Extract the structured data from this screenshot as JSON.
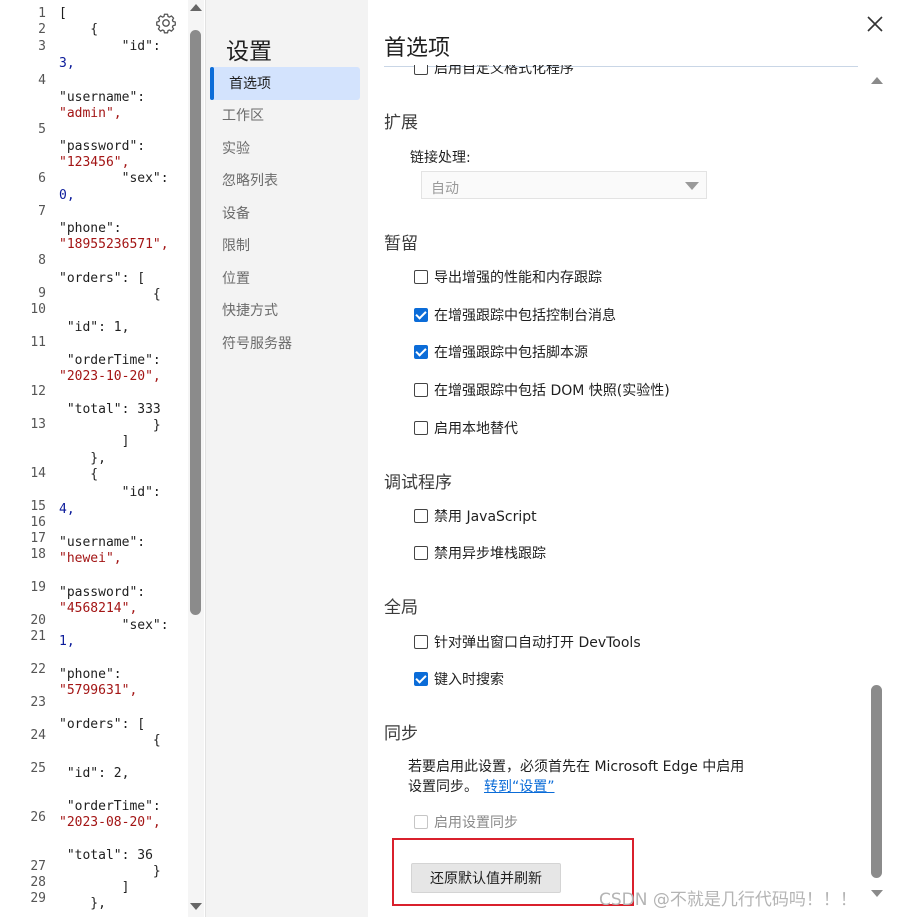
{
  "code": {
    "line_numbers": [
      "1",
      "2",
      "3",
      "4",
      "5",
      "6",
      "7",
      "8",
      "9",
      "10",
      "11",
      "12",
      "13",
      "14",
      "15",
      "16",
      "17",
      "18",
      "19",
      "20",
      "21",
      "22",
      "23",
      "24",
      "25",
      "26",
      "27",
      "28",
      "29"
    ],
    "lines": [
      {
        "text": "[",
        "kind": "k"
      },
      {
        "text": "    {",
        "kind": "k"
      },
      {
        "text": "        \"id\":",
        "kind": "k"
      },
      {
        "text": "3,",
        "kind": "n"
      },
      {
        "text": "\"username\":",
        "kind": "k"
      },
      {
        "text": "\"admin\",",
        "kind": "s"
      },
      {
        "text": "\"password\":",
        "kind": "k"
      },
      {
        "text": "\"123456\",",
        "kind": "s"
      },
      {
        "text": "        \"sex\":",
        "kind": "k"
      },
      {
        "text": "0,",
        "kind": "n"
      },
      {
        "text": "\"phone\":",
        "kind": "k"
      },
      {
        "text": "\"18955236571\",",
        "kind": "s"
      },
      {
        "text": "\"orders\": [",
        "kind": "k"
      },
      {
        "text": "            {",
        "kind": "k"
      },
      {
        "text": " \"id\": 1,",
        "kind": "k"
      },
      {
        "text": " \"orderTime\":",
        "kind": "k"
      },
      {
        "text": "\"2023-10-20\",",
        "kind": "s"
      },
      {
        "text": " \"total\": 333",
        "kind": "k"
      },
      {
        "text": "            }",
        "kind": "k"
      },
      {
        "text": "        ]",
        "kind": "k"
      },
      {
        "text": "    },",
        "kind": "k"
      },
      {
        "text": "    {",
        "kind": "k"
      },
      {
        "text": "        \"id\":",
        "kind": "k"
      },
      {
        "text": "4,",
        "kind": "n"
      },
      {
        "text": "\"username\":",
        "kind": "k"
      },
      {
        "text": "\"hewei\",",
        "kind": "s"
      },
      {
        "text": "\"password\":",
        "kind": "k"
      },
      {
        "text": "\"4568214\",",
        "kind": "s"
      },
      {
        "text": "        \"sex\":",
        "kind": "k"
      },
      {
        "text": "1,",
        "kind": "n"
      },
      {
        "text": "\"phone\":",
        "kind": "k"
      },
      {
        "text": "\"5799631\",",
        "kind": "s"
      },
      {
        "text": "\"orders\": [",
        "kind": "k"
      },
      {
        "text": "            {",
        "kind": "k"
      },
      {
        "text": " \"id\": 2,",
        "kind": "k"
      },
      {
        "text": " \"orderTime\":",
        "kind": "k"
      },
      {
        "text": "\"2023-08-20\",",
        "kind": "s"
      },
      {
        "text": " \"total\": 36",
        "kind": "k"
      },
      {
        "text": "            }",
        "kind": "k"
      },
      {
        "text": "        ]",
        "kind": "k"
      },
      {
        "text": "    },",
        "kind": "k"
      }
    ]
  },
  "nav": {
    "title": "设置",
    "items": [
      "首选项",
      "工作区",
      "实验",
      "忽略列表",
      "设备",
      "限制",
      "位置",
      "快捷方式",
      "符号服务器"
    ]
  },
  "main": {
    "title": "首选项",
    "cut_off_item": "启用自定义格式化程序",
    "sections": {
      "extensions": "扩展",
      "persistence": "暂留",
      "debugger": "调试程序",
      "global": "全局",
      "sync": "同步"
    },
    "link_handling": {
      "label": "链接处理:",
      "value": "自动"
    },
    "persistence_items": [
      {
        "label": "导出增强的性能和内存跟踪",
        "checked": false
      },
      {
        "label": "在增强跟踪中包括控制台消息",
        "checked": true
      },
      {
        "label": "在增强跟踪中包括脚本源",
        "checked": true
      },
      {
        "label": "在增强跟踪中包括 DOM 快照(实验性)",
        "checked": false
      },
      {
        "label": "启用本地替代",
        "checked": false
      }
    ],
    "debugger_items": [
      {
        "label": "禁用 JavaScript",
        "checked": false
      },
      {
        "label": "禁用异步堆栈跟踪",
        "checked": false
      }
    ],
    "global_items": [
      {
        "label": "针对弹出窗口自动打开 DevTools",
        "checked": false
      },
      {
        "label": "键入时搜索",
        "checked": true
      }
    ],
    "sync": {
      "text": "若要启用此设置，必须首先在 Microsoft Edge 中启用设置同步。",
      "link": "转到“设置”",
      "checkbox_label": "启用设置同步"
    },
    "reset_button": "还原默认值并刷新",
    "watermark": "CSDN @不就是几行代码吗！！！"
  },
  "colors": {
    "accent": "#0b6cd8",
    "nav_active_bg": "#d3e3fd",
    "highlight_box": "#d9202c",
    "json_string": "#a31515",
    "json_number": "#0a1a9a"
  },
  "icons": {
    "gear": "gear-icon",
    "close": "close-icon"
  }
}
